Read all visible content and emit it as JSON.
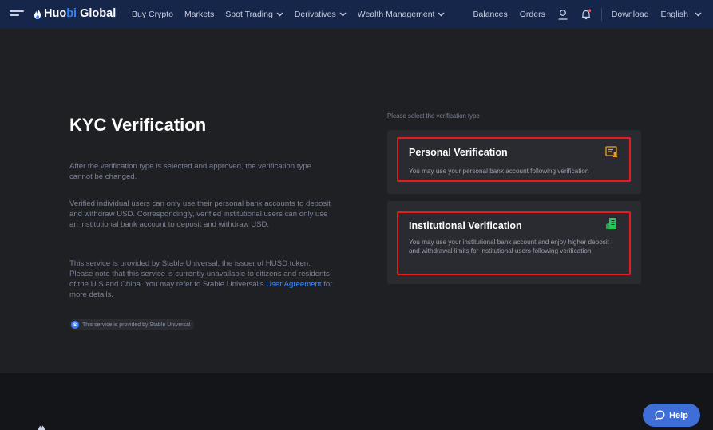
{
  "nav": {
    "logo_part1": "Huo",
    "logo_part2": "bi",
    "logo_part3": " Global",
    "links": [
      {
        "label": "Buy Crypto",
        "has_chevron": false
      },
      {
        "label": "Markets",
        "has_chevron": false
      },
      {
        "label": "Spot Trading",
        "has_chevron": true
      },
      {
        "label": "Derivatives",
        "has_chevron": true
      },
      {
        "label": "Wealth Management",
        "has_chevron": true
      }
    ],
    "balances": "Balances",
    "orders": "Orders",
    "download": "Download",
    "language": "English"
  },
  "main": {
    "title": "KYC Verification",
    "p1": "After the verification type is selected and approved, the verification type cannot be changed.",
    "p2": "Verified individual users can only use their personal bank accounts to deposit and withdraw USD. Correspondingly, verified institutional users can only use an institutional bank account to deposit and withdraw USD.",
    "p3_before": "This service is provided by Stable Universal, the issuer of HUSD token. Please note that this service is currently unavailable to citizens and residents of the U.S and China. You may refer to Stable Universal’s ",
    "p3_link": "User Agreement",
    "p3_after": " for more details.",
    "provided_icon_letter": "S",
    "provided_text": "This service is provided by Stable Universal",
    "select_label": "Please select the verification type",
    "personal": {
      "title": "Personal Verification",
      "desc": "You may use your personal bank account following verification"
    },
    "institutional": {
      "title": "Institutional Verification",
      "desc": "You may use your institutional bank account and enjoy higher deposit and withdrawal limits for institutional users following verification"
    }
  },
  "footer": {
    "help": "Help"
  },
  "colors": {
    "nav_bg": "#16254a",
    "page_bg": "#1f2024",
    "card_bg": "#2a2b30",
    "highlight": "#e02020",
    "link": "#3d8bff",
    "help_bg": "#3f6fd6",
    "personal_icon": "#f0a020",
    "institutional_icon": "#27c45e"
  }
}
